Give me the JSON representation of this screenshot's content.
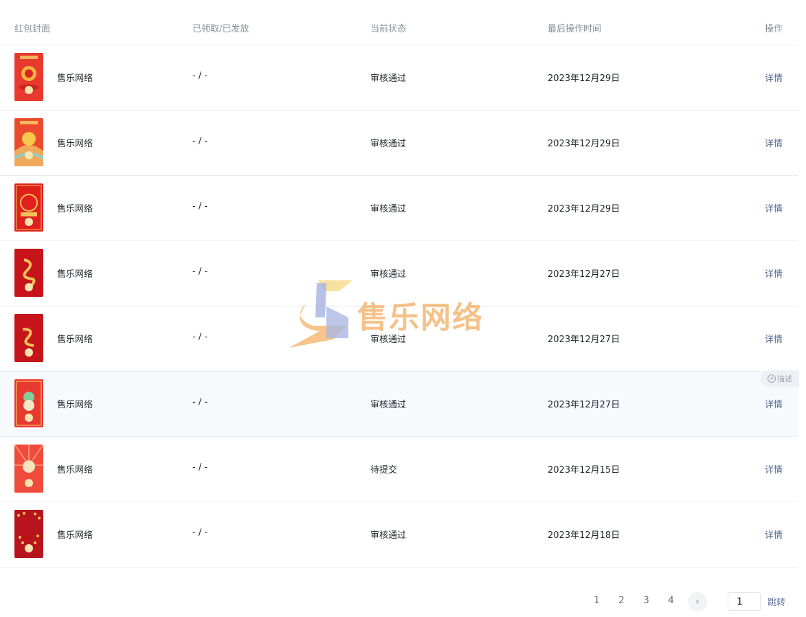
{
  "header": {
    "cover": "红包封面",
    "count": "已领取/已发放",
    "status": "当前状态",
    "time": "最后操作时间",
    "action": "操作"
  },
  "rows": [
    {
      "name": "售乐网络",
      "count": "- / -",
      "status": "审核通过",
      "time": "2023年12月29日",
      "action": "详情"
    },
    {
      "name": "售乐网络",
      "count": "- / -",
      "status": "审核通过",
      "time": "2023年12月29日",
      "action": "详情"
    },
    {
      "name": "售乐网络",
      "count": "- / -",
      "status": "审核通过",
      "time": "2023年12月29日",
      "action": "详情"
    },
    {
      "name": "售乐网络",
      "count": "- / -",
      "status": "审核通过",
      "time": "2023年12月27日",
      "action": "详情"
    },
    {
      "name": "售乐网络",
      "count": "- / -",
      "status": "审核通过",
      "time": "2023年12月27日",
      "action": "详情"
    },
    {
      "name": "售乐网络",
      "count": "- / -",
      "status": "审核通过",
      "time": "2023年12月27日",
      "action": "详情"
    },
    {
      "name": "售乐网络",
      "count": "- / -",
      "status": "待提交",
      "time": "2023年12月15日",
      "action": "详情"
    },
    {
      "name": "售乐网络",
      "count": "- / -",
      "status": "审核通过",
      "time": "2023年12月18日",
      "action": "详情"
    }
  ],
  "describe_tag": "描述",
  "watermark_text": "售乐网络",
  "pagination": {
    "pages": [
      "1",
      "2",
      "3",
      "4"
    ],
    "next_icon": "chevron-right-icon",
    "input_value": "1",
    "jump_label": "跳转"
  },
  "colors": {
    "link": "#576b95",
    "cover_red": "#e8392e",
    "row_hover": "#f7fafd"
  }
}
